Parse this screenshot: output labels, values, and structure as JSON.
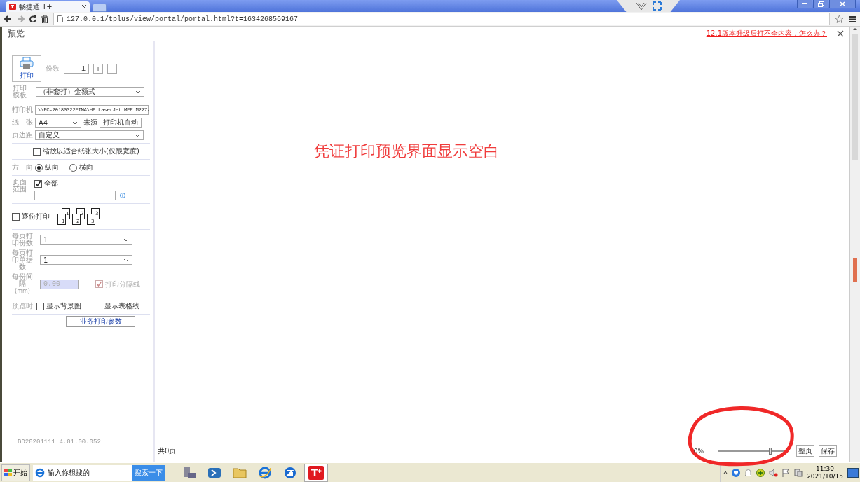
{
  "browser": {
    "tab_title": "畅捷通 T+",
    "url": "127.0.0.1/tplus/view/portal/portal.html?t=1634268569167"
  },
  "dialog": {
    "title": "预览",
    "help_link": "12.1版本升级后打不全内容，怎么办？"
  },
  "settings": {
    "print_button": "打印",
    "copies": {
      "label": "份数",
      "value": "1",
      "plus": "+",
      "minus": "-"
    },
    "template": {
      "label": "打印模板",
      "value": "（非套打）金额式"
    },
    "printer": {
      "label": "打印机",
      "value": "\\\\FC-20180322FIMA\\HP LaserJet MFP M227-"
    },
    "paper": {
      "label": "纸　张",
      "value": "A4",
      "source_label": "来源",
      "source_value": "打印机自动"
    },
    "margin": {
      "label": "页边距",
      "value": "自定义"
    },
    "fit_to_paper": {
      "label": "缩放以适合纸张大小(仅限宽度)",
      "checked": false
    },
    "orientation": {
      "label": "方　向",
      "options": [
        {
          "label": "纵向",
          "selected": true
        },
        {
          "label": "横向",
          "selected": false
        }
      ]
    },
    "page_range": {
      "label": "页面范围",
      "all": {
        "label": "全部",
        "checked": true
      }
    },
    "collate": {
      "label": "逐份打印",
      "checked": false,
      "page_stacks": [
        {
          "back": "1",
          "front": "1"
        },
        {
          "back": "2",
          "front": "2"
        },
        {
          "back": "3",
          "front": "3"
        }
      ]
    },
    "copies_per_page": {
      "label": "每页打印份数",
      "value": "1"
    },
    "docs_per_page": {
      "label": "每页打印单据数",
      "value": "1"
    },
    "spacing": {
      "label": "每份间隔",
      "unit": "(mm)",
      "value": "0.00",
      "disabled": true
    },
    "separator": {
      "label": "打印分隔线",
      "checked": true,
      "disabled": true
    },
    "preview_label": "预览时",
    "show_background": {
      "label": "显示背景图",
      "checked": false
    },
    "show_grid": {
      "label": "显示表格线",
      "checked": false
    },
    "business_params_button": "业务打印参数",
    "version": "BD20201111 4.01.00.052"
  },
  "preview": {
    "annotation": "凭证打印预览界面显示空白",
    "page_count": "共0页",
    "zoom": {
      "reading": "0%",
      "level": 0.8
    },
    "buttons": [
      "整页",
      "保存"
    ]
  },
  "taskbar": {
    "start": "开始",
    "search_placeholder": "输入你想搜的",
    "search_button": "搜索一下",
    "time": "11:30",
    "date": "2021/10/15"
  }
}
